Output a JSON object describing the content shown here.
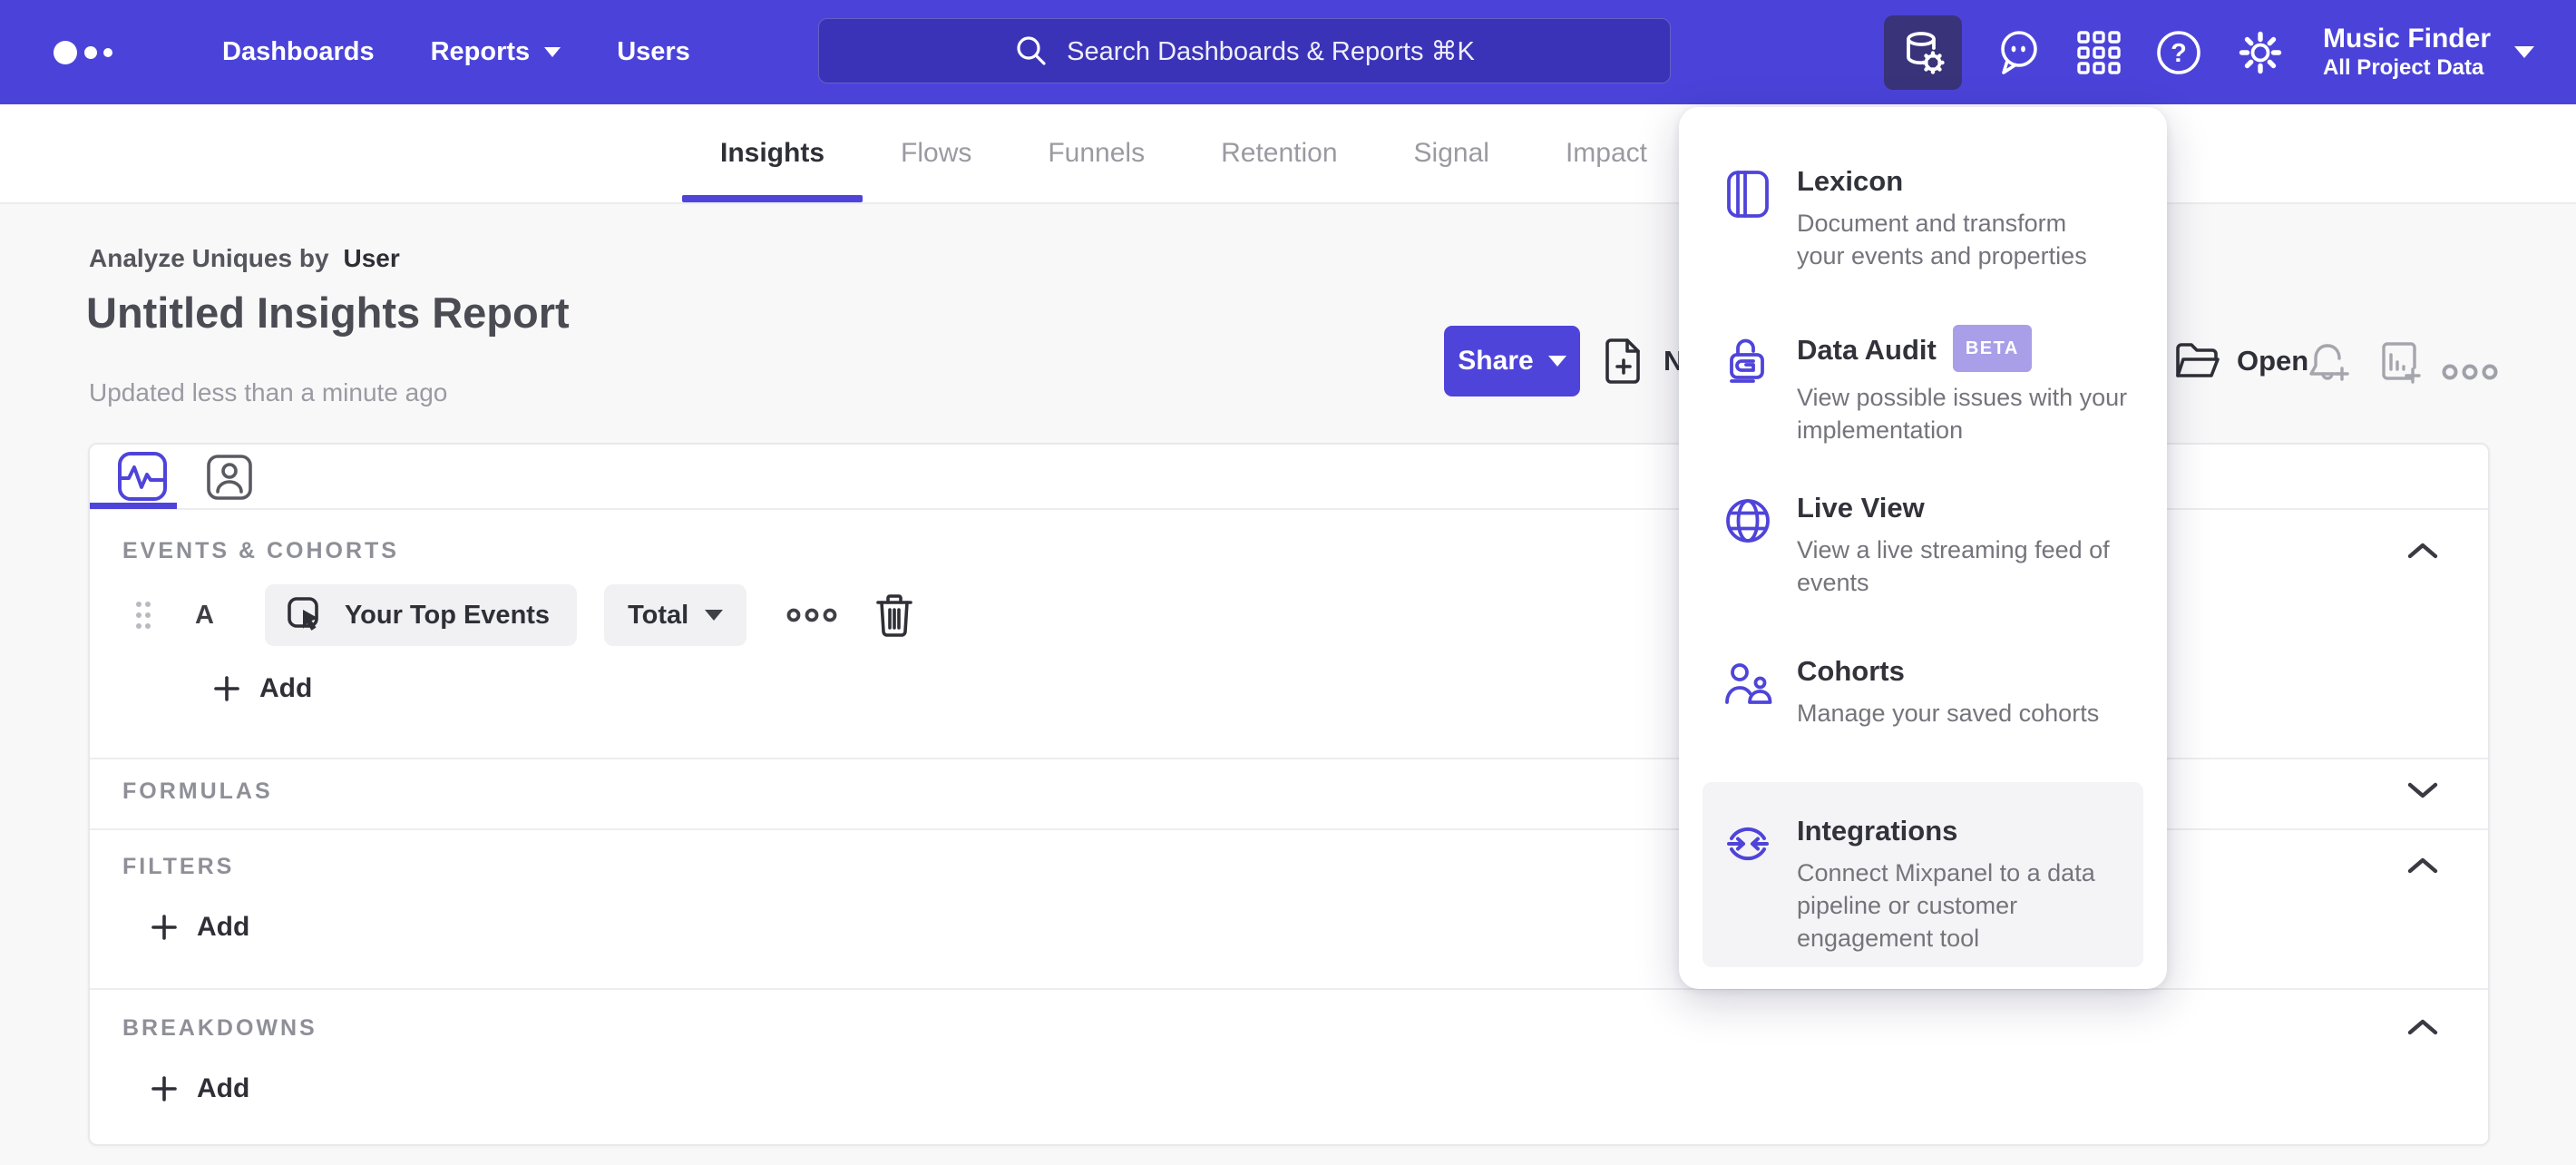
{
  "colors": {
    "accent": "#4f44d9",
    "nav_background": "#4b43d9",
    "beta_badge": "#a89fe8"
  },
  "nav": {
    "links": [
      {
        "label": "Dashboards"
      },
      {
        "label": "Reports"
      },
      {
        "label": "Users"
      }
    ],
    "search_placeholder": "Search Dashboards & Reports ⌘K",
    "project": {
      "name": "Music Finder",
      "scope": "All Project Data"
    }
  },
  "tabs": [
    {
      "label": "Insights",
      "active": true
    },
    {
      "label": "Flows"
    },
    {
      "label": "Funnels"
    },
    {
      "label": "Retention"
    },
    {
      "label": "Signal"
    },
    {
      "label": "Impact"
    }
  ],
  "report": {
    "eyebrow_label": "Analyze Uniques by",
    "eyebrow_value": "User",
    "title": "Untitled Insights Report",
    "updated": "Updated less than a minute ago",
    "share_label": "Share",
    "new_label": "New",
    "open_label": "Open"
  },
  "builder": {
    "events_header": "EVENTS & COHORTS",
    "formulas_header": "FORMULAS",
    "filters_header": "FILTERS",
    "breakdowns_header": "BREAKDOWNS",
    "add_label": "Add",
    "event_row": {
      "letter": "A",
      "event": "Your Top Events",
      "aggregation": "Total"
    }
  },
  "menu": {
    "items": [
      {
        "title": "Lexicon",
        "description": "Document and transform your events and properties"
      },
      {
        "title": "Data Audit",
        "badge": "BETA",
        "description": "View possible issues with your implementation"
      },
      {
        "title": "Live View",
        "description": "View a live streaming feed of events"
      },
      {
        "title": "Cohorts",
        "description": "Manage your saved cohorts"
      },
      {
        "title": "Integrations",
        "description": "Connect Mixpanel to a data pipeline or customer engagement tool"
      }
    ]
  }
}
